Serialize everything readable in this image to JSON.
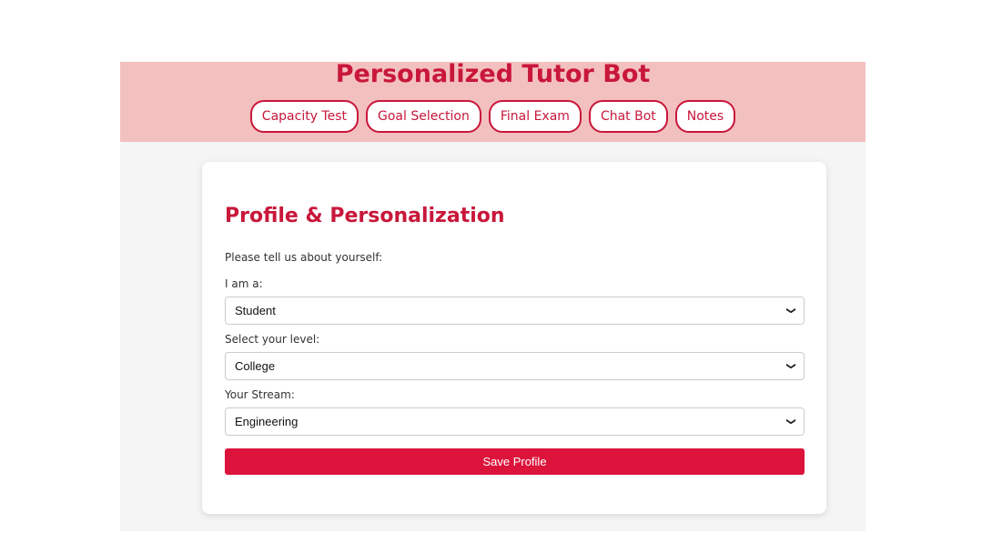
{
  "header": {
    "title": "Personalized Tutor Bot",
    "nav": [
      {
        "label": "Capacity Test"
      },
      {
        "label": "Goal Selection"
      },
      {
        "label": "Final Exam"
      },
      {
        "label": "Chat Bot"
      },
      {
        "label": "Notes"
      }
    ]
  },
  "profile": {
    "title": "Profile & Personalization",
    "intro": "Please tell us about yourself:",
    "role": {
      "label": "I am a:",
      "value": "Student"
    },
    "level": {
      "label": "Select your level:",
      "value": "College"
    },
    "stream": {
      "label": "Your Stream:",
      "value": "Engineering"
    },
    "save_label": "Save Profile"
  },
  "colors": {
    "accent": "#c8173a",
    "button": "#dc143c",
    "header_bg": "#f3c0c0"
  },
  "icons": {
    "select_indicator": "chevron-down-icon"
  }
}
